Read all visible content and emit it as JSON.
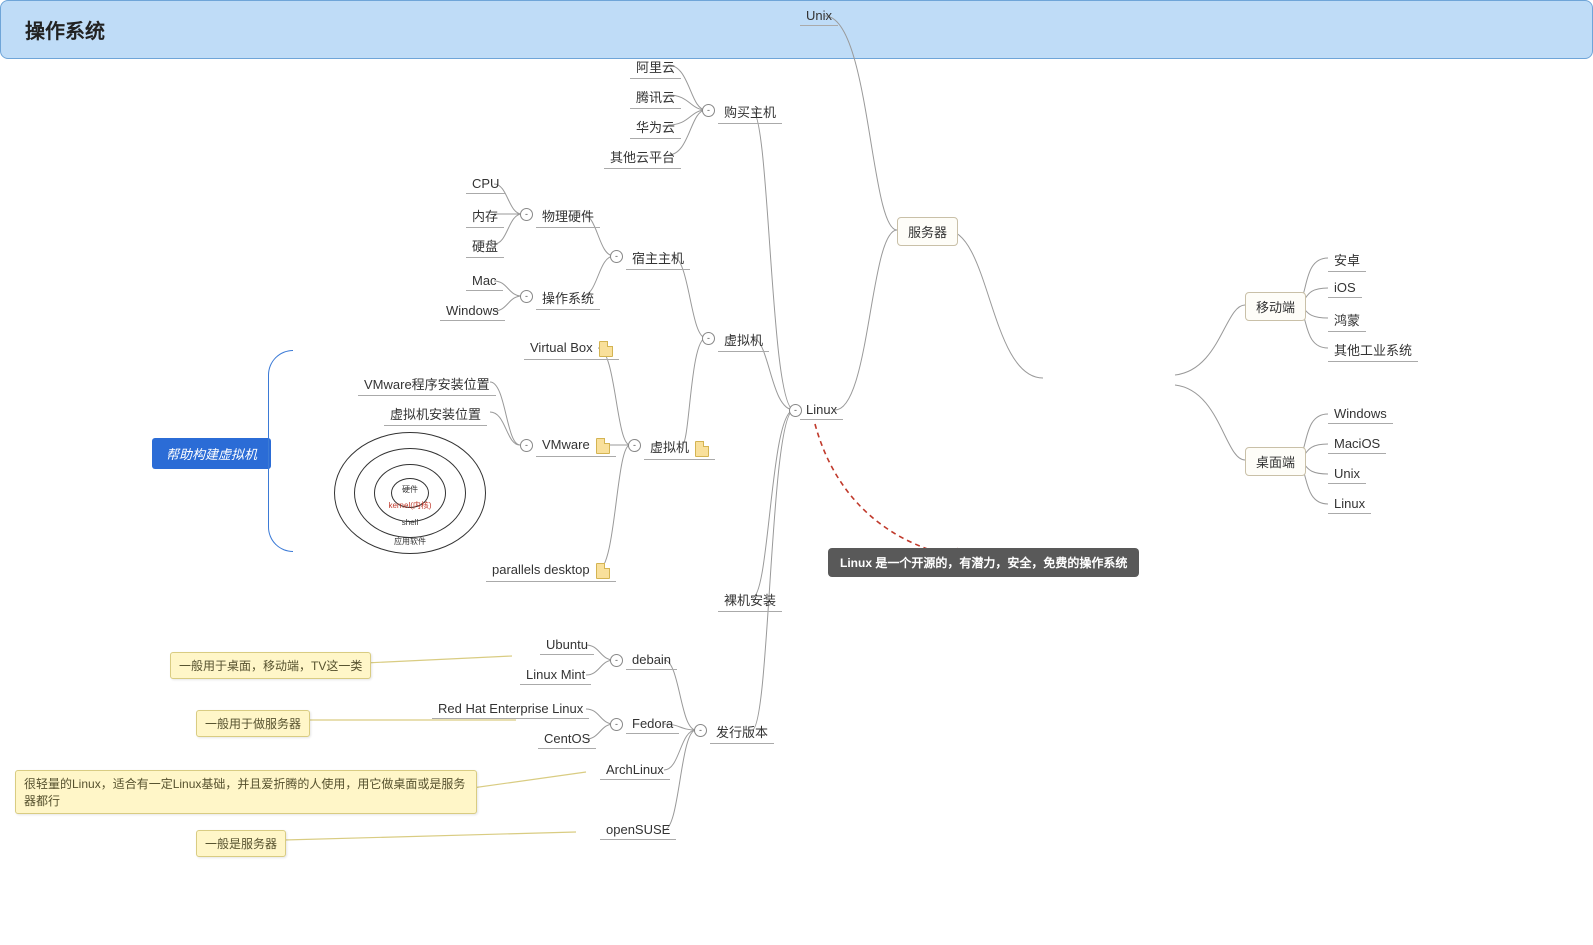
{
  "root": "操作系统",
  "mobile": {
    "title": "移动端",
    "items": [
      "安卓",
      "iOS",
      "鸿蒙",
      "其他工业系统"
    ]
  },
  "desktop": {
    "title": "桌面端",
    "items": [
      "Windows",
      "MaciOS",
      "Unix",
      "Linux"
    ]
  },
  "server": {
    "title": "服务器",
    "unix": "Unix",
    "linux": "Linux",
    "buy": {
      "title": "购买主机",
      "items": [
        "阿里云",
        "腾讯云",
        "华为云",
        "其他云平台"
      ]
    },
    "vm": {
      "title": "虚拟机",
      "host": {
        "title": "宿主主机",
        "hw": {
          "title": "物理硬件",
          "items": [
            "CPU",
            "内存",
            "硬盘"
          ]
        },
        "os": {
          "title": "操作系统",
          "items": [
            "Mac",
            "Windows"
          ]
        }
      },
      "vms": {
        "title": "虚拟机",
        "virtualbox": "Virtual Box",
        "vmware": {
          "title": "VMware",
          "items": [
            "VMware程序安装位置",
            "虚拟机安装位置"
          ]
        },
        "parallels": "parallels desktop"
      }
    },
    "bare": "裸机安装",
    "dist": {
      "title": "发行版本",
      "debian": {
        "title": "debain",
        "items": [
          "Ubuntu",
          "Linux Mint"
        ]
      },
      "fedora": {
        "title": "Fedora",
        "items": [
          "Red Hat Enterprise Linux",
          "CentOS"
        ]
      },
      "arch": "ArchLinux",
      "suse": "openSUSE"
    }
  },
  "annotations": {
    "vm_helper": "帮助构建虚拟机",
    "linux_desc": "Linux 是一个开源的，有潜力，安全，免费的操作系统",
    "debian_tag": "一般用于桌面，移动端，TV这一类",
    "fedora_tag": "一般用于做服务器",
    "arch_tag": "很轻量的Linux，适合有一定Linux基础，并且爱折腾的人使用，用它做桌面或是服务器都行",
    "suse_tag": "一般是服务器"
  },
  "ring": {
    "l1": "硬件",
    "l2": "kernel(内核)",
    "l3": "shell",
    "l4": "应用软件"
  }
}
